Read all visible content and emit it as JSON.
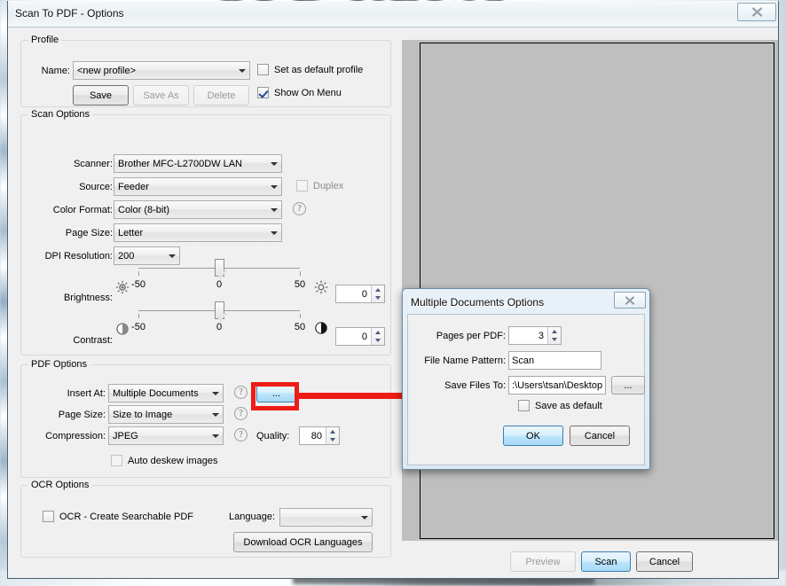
{
  "desktop": {
    "background_text": "OLD NEWS"
  },
  "window": {
    "title": "Scan To PDF - Options",
    "close_icon": "close-icon"
  },
  "profile": {
    "group_title": "Profile",
    "name_label": "Name:",
    "name_value": "<new profile>",
    "set_default_label": "Set as default profile",
    "set_default_checked": false,
    "show_on_menu_label": "Show On Menu",
    "show_on_menu_checked": true,
    "save_label": "Save",
    "save_as_label": "Save As",
    "delete_label": "Delete"
  },
  "scan_options": {
    "group_title": "Scan Options",
    "scanner_label": "Scanner:",
    "scanner_value": "Brother MFC-L2700DW LAN",
    "source_label": "Source:",
    "source_value": "Feeder",
    "duplex_label": "Duplex",
    "duplex_checked": false,
    "color_format_label": "Color Format:",
    "color_format_value": "Color (8-bit)",
    "page_size_label": "Page Size:",
    "page_size_value": "Letter",
    "dpi_label": "DPI Resolution:",
    "dpi_value": "200",
    "brightness_label": "Brightness:",
    "brightness_min": "-50",
    "brightness_mid": "0",
    "brightness_max": "50",
    "brightness_value": "0",
    "contrast_label": "Contrast:",
    "contrast_min": "-50",
    "contrast_mid": "0",
    "contrast_max": "50",
    "contrast_value": "0"
  },
  "pdf_options": {
    "group_title": "PDF Options",
    "insert_at_label": "Insert At:",
    "insert_at_value": "Multiple Documents",
    "ellipsis_label": "...",
    "page_size_label": "Page Size:",
    "page_size_value": "Size to Image",
    "compression_label": "Compression:",
    "compression_value": "JPEG",
    "quality_label": "Quality:",
    "quality_value": "80",
    "auto_deskew_label": "Auto deskew images",
    "auto_deskew_checked": false,
    "help_icon": "help-icon"
  },
  "ocr_options": {
    "group_title": "OCR Options",
    "ocr_checkbox_label": "OCR - Create Searchable PDF",
    "ocr_checkbox_checked": false,
    "language_label": "Language:",
    "language_value": "",
    "download_label": "Download OCR Languages"
  },
  "footer": {
    "preview_label": "Preview",
    "scan_label": "Scan",
    "cancel_label": "Cancel"
  },
  "dialog": {
    "title": "Multiple Documents Options",
    "pages_per_pdf_label": "Pages per PDF:",
    "pages_per_pdf_value": "3",
    "file_name_pattern_label": "File Name Pattern:",
    "file_name_pattern_value": "Scan",
    "save_files_to_label": "Save Files To:",
    "save_files_to_value": ":\\Users\\tsan\\Desktop",
    "browse_label": "...",
    "save_as_default_label": "Save as default",
    "save_as_default_checked": false,
    "ok_label": "OK",
    "cancel_label": "Cancel",
    "close_icon": "close-icon"
  },
  "annotation": {
    "color": "#ed1c16",
    "shape": "callout-box-with-line"
  },
  "colors": {
    "accent_blue": "#3c7fb1",
    "window_bg": "#f0f0f0",
    "preview_bg": "#bfbfbf",
    "annotation_red": "#ed1c16"
  }
}
